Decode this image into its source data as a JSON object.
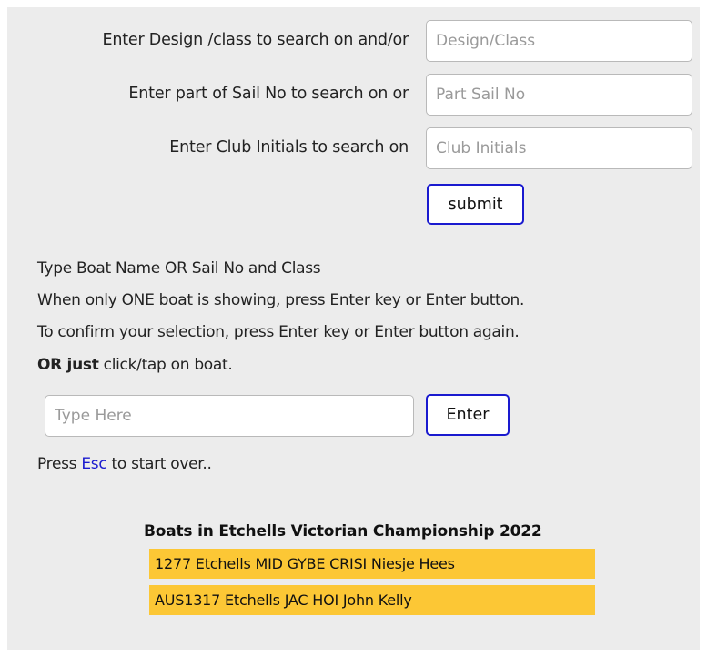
{
  "search_form": {
    "design_label": "Enter Design /class to search on and/or",
    "design_placeholder": "Design/Class",
    "sail_label": "Enter part of Sail No to search on or",
    "sail_placeholder": "Part Sail No",
    "club_label": "Enter Club Initials to search on",
    "club_placeholder": "Club Initials",
    "submit_label": "submit"
  },
  "instructions": {
    "line1": "Type Boat Name OR Sail No and Class",
    "line2": "When only ONE boat is showing, press Enter key or Enter button.",
    "line3": "To confirm your selection, press Enter key or Enter button again.",
    "line4_bold": "OR just",
    "line4_rest": " click/tap on boat."
  },
  "boat_search": {
    "placeholder": "Type Here",
    "enter_label": "Enter"
  },
  "esc_hint": {
    "prefix": "Press ",
    "link": "Esc",
    "suffix": " to start over.."
  },
  "boats": {
    "title": "Boats in Etchells Victorian Championship 2022",
    "items": [
      "1277 Etchells MID GYBE CRISI Niesje Hees",
      "AUS1317 Etchells JAC HOI John Kelly"
    ],
    "highlight_color": "#fcc735"
  },
  "colors": {
    "panel_background": "#ececec",
    "button_border": "#1a1acf",
    "link": "#1a1acf"
  }
}
